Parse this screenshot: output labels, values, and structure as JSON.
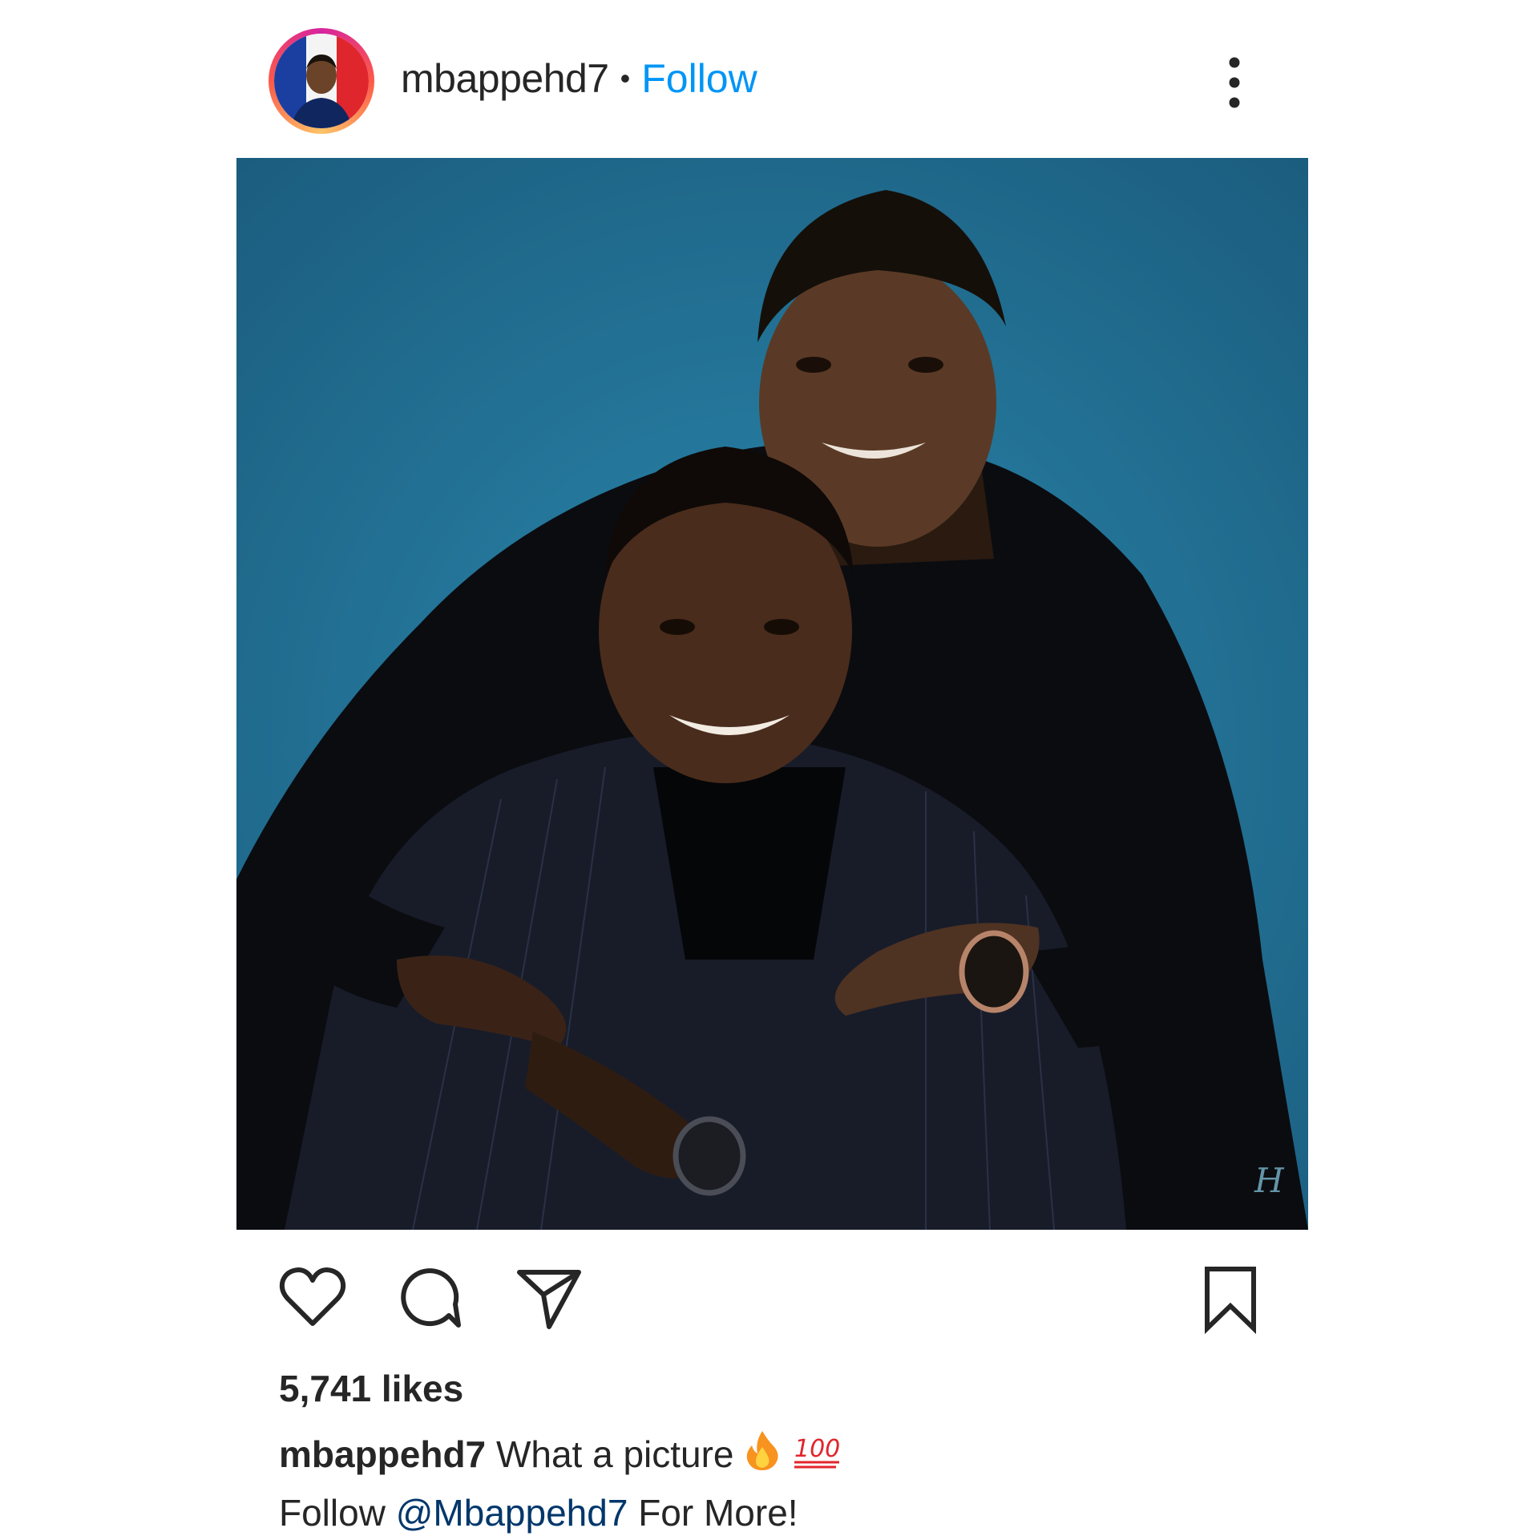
{
  "post": {
    "author": {
      "username": "mbappehd7",
      "separator": "•",
      "follow_label": "Follow"
    },
    "stats": {
      "likes_text": "5,741 likes"
    },
    "caption": {
      "username": "mbappehd7",
      "text": "What a picture",
      "emojis": [
        "fire-emoji",
        "hundred-points-emoji"
      ],
      "line2_prefix": "Follow",
      "mention": "@Mbappehd7",
      "line2_suffix": "For More!"
    }
  },
  "icons": {
    "like": "heart-icon",
    "comment": "comment-bubble-icon",
    "share": "paper-plane-icon",
    "save": "bookmark-icon",
    "more": "more-options-icon"
  },
  "colors": {
    "follow": "#0095f6",
    "mention": "#00376b",
    "text": "#262626",
    "photo_background": "#22779b"
  }
}
